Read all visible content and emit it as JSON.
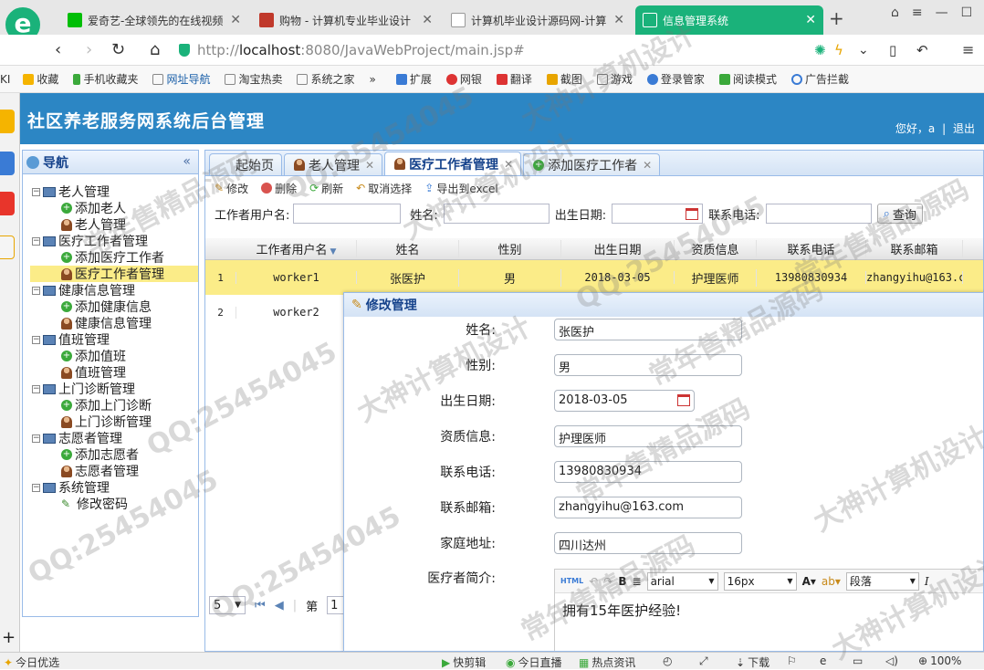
{
  "browser": {
    "tabs": [
      {
        "label": "爱奇艺-全球领先的在线视频",
        "favicon_color": "#00be06"
      },
      {
        "label": "购物 - 计算机专业毕业设计",
        "favicon_color": "#c0392b"
      },
      {
        "label": "计算机毕业设计源码网-计算",
        "favicon_color": "#ffffff"
      },
      {
        "label": "信息管理系统",
        "favicon_color": "#ffffff"
      }
    ],
    "url_prefix": "http://",
    "url_host": "localhost",
    "url_path": ":8080/JavaWebProject/main.jsp#",
    "bookmarks": [
      "收藏",
      "手机收藏夹",
      "网址导航",
      "淘宝热卖",
      "系统之家",
      "»",
      "扩展",
      "网银",
      "翻译",
      "截图",
      "游戏",
      "登录管家",
      "阅读模式",
      "广告拦截"
    ],
    "bookmark_left_cut": "KI"
  },
  "app": {
    "title": "社区养老服务网系统后台管理",
    "greeting": "您好，a",
    "logout": "退出",
    "accent": "#2c86c4"
  },
  "nav": {
    "title": "导航",
    "collapse": "«",
    "groups": [
      {
        "label": "老人管理",
        "items": [
          "添加老人",
          "老人管理"
        ]
      },
      {
        "label": "医疗工作者管理",
        "items": [
          "添加医疗工作者",
          "医疗工作者管理"
        ]
      },
      {
        "label": "健康信息管理",
        "items": [
          "添加健康信息",
          "健康信息管理"
        ]
      },
      {
        "label": "值班管理",
        "items": [
          "添加值班",
          "值班管理"
        ]
      },
      {
        "label": "上门诊断管理",
        "items": [
          "添加上门诊断",
          "上门诊断管理"
        ]
      },
      {
        "label": "志愿者管理",
        "items": [
          "添加志愿者",
          "志愿者管理"
        ]
      },
      {
        "label": "系统管理",
        "items": [
          "修改密码"
        ]
      }
    ]
  },
  "content_tabs": [
    "起始页",
    "老人管理",
    "医疗工作者管理",
    "添加医疗工作者"
  ],
  "toolbar": [
    "修改",
    "删除",
    "刷新",
    "取消选择",
    "导出到excel"
  ],
  "search": {
    "username_label": "工作者用户名:",
    "name_label": "姓名:",
    "birth_label": "出生日期:",
    "phone_label": "联系电话:",
    "query": "查询"
  },
  "grid": {
    "columns": [
      "工作者用户名",
      "姓名",
      "性别",
      "出生日期",
      "资质信息",
      "联系电话",
      "联系邮箱"
    ],
    "rows": [
      {
        "num": "1",
        "cells": [
          "worker1",
          "张医护",
          "男",
          "2018-03-05",
          "护理医师",
          "13980830934",
          "zhangyihu@163.c"
        ]
      },
      {
        "num": "2",
        "cells": [
          "worker2",
          "",
          "",
          "",
          "",
          "",
          ""
        ]
      }
    ]
  },
  "pager": {
    "page_size": "5",
    "page_label": "第",
    "page_value": "1"
  },
  "dialog": {
    "title": "修改管理",
    "fields": [
      {
        "label": "姓名:",
        "value": "张医护"
      },
      {
        "label": "性别:",
        "value": "男"
      },
      {
        "label": "出生日期:",
        "value": "2018-03-05"
      },
      {
        "label": "资质信息:",
        "value": "护理医师"
      },
      {
        "label": "联系电话:",
        "value": "13980830934"
      },
      {
        "label": "联系邮箱:",
        "value": "zhangyihu@163.com"
      },
      {
        "label": "家庭地址:",
        "value": "四川达州"
      }
    ],
    "intro_label": "医疗者简介:",
    "editor": {
      "html": "HTML",
      "font": "arial",
      "size": "16px",
      "para": "段落",
      "content": "拥有15年医护经验!"
    }
  },
  "statusbar": [
    "今日优选",
    "快剪辑",
    "今日直播",
    "热点资讯",
    "下载",
    "100%"
  ],
  "watermark": {
    "texts": [
      "QQ:25454045",
      "常年售精品源码",
      "大神计算机设计",
      "QQ:25454045",
      "常年售精品源码",
      "大神计算机设计"
    ]
  }
}
